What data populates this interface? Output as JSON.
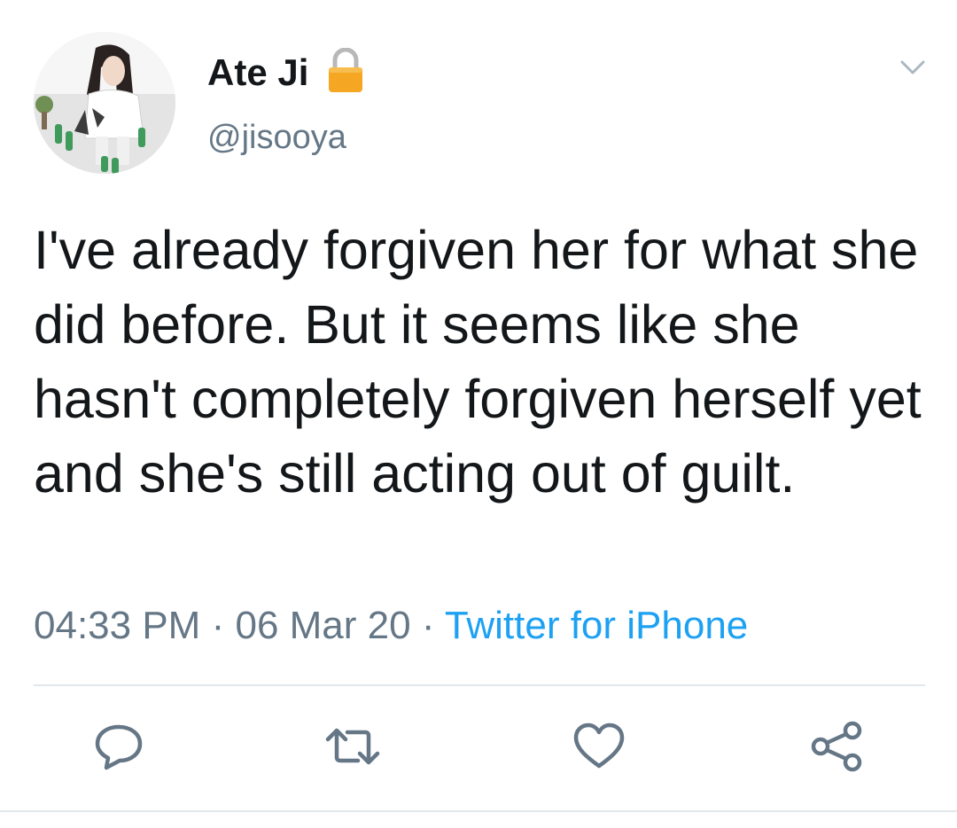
{
  "user": {
    "display_name": "Ate Ji",
    "handle": "@jisooya",
    "avatar_icon": "profile-photo",
    "protected_icon": "lock-icon"
  },
  "tweet": {
    "text": "I've already forgiven her for what she did before. But it seems like she hasn't completely forgiven herself yet and she's still acting out of guilt.",
    "time": "04:33 PM",
    "separator": "·",
    "date": "06 Mar 20",
    "source": "Twitter for iPhone"
  },
  "actions": {
    "reply_icon": "reply-icon",
    "retweet_icon": "retweet-icon",
    "like_icon": "heart-icon",
    "share_icon": "share-icon",
    "menu_icon": "chevron-down-icon"
  },
  "colors": {
    "text_primary": "#14171a",
    "text_secondary": "#657786",
    "link": "#1da1f2",
    "divider": "#e1e8ed",
    "lock": "#f5a623"
  }
}
